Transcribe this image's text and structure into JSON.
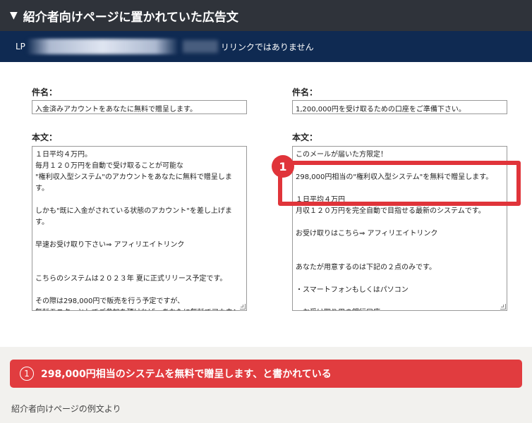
{
  "header": {
    "toggle_icon": "▼",
    "title": "紹介者向けページに置かれていた広告文"
  },
  "lp_bar": {
    "prefix": "LP",
    "suffix": "リリンクではありません"
  },
  "left": {
    "subject_label": "件名：",
    "subject_value": "入金済みアカウントをあなたに無料で贈呈します。",
    "body_label": "本文：",
    "lines": [
      "１日平均４万円。",
      "毎月１２０万円を自動で受け取ることが可能な",
      "\"権利収入型システム\"のアカウントをあなたに無料で贈呈しま",
      "す。",
      "",
      "しかも\"既に入金がされている状態のアカウント\"を差し上げま",
      "す。",
      "",
      "早速お受け取り下さい⇒ アフィリエイトリンク",
      "",
      "",
      "こちらのシステムは２０２３年 夏に正式リリース予定です。",
      "",
      "その際は298,000円で販売を行う予定ですが、",
      "無料モニターとしてご参加を頂ければ、あなたに無料でアカウン"
    ]
  },
  "right": {
    "subject_label": "件名：",
    "subject_value": "1,200,000円を受け取るための口座をご準備下さい。",
    "body_label": "本文：",
    "lines": [
      "このメールが届いた方限定！",
      "",
      "298,000円相当の\"権利収入型システム\"を無料で贈呈します。",
      "",
      "１日平均４万円",
      "月収１２０万円を完全自動で目指せる最新のシステムです。",
      "",
      "お受け取りはこちら⇒ アフィリエイトリンク",
      "",
      "",
      "あなたが用意するのは下記の２点のみです。",
      "",
      "・スマートフォンもしくはパソコン",
      "",
      "・お受け取り用の銀行口座"
    ]
  },
  "marker": {
    "number": "1"
  },
  "callout": {
    "number": "1",
    "text": "298,000円相当のシステムを無料で贈呈します、と書かれている"
  },
  "caption": "紹介者向けページの例文より",
  "colors": {
    "title_bg": "#2f333a",
    "lp_bg": "#0f2a52",
    "accent_red": "#e0343a",
    "footer_bg": "#f2f1ee"
  }
}
